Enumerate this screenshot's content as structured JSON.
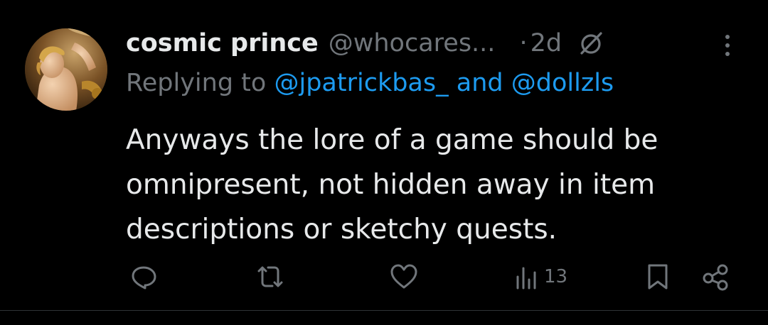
{
  "tweet": {
    "author": {
      "display_name": "cosmic prince",
      "handle": "@whocares...",
      "avatar_icon": "avatar-image"
    },
    "separator": "·",
    "timestamp": "2d",
    "reply": {
      "prefix": "Replying to",
      "mention1": "@jpatrickbas_",
      "conjunction": "and",
      "mention2": "@dollzls"
    },
    "text": "Anyways the lore of a game should be omnipresent, not hidden away in item descriptions or sketchy quests.",
    "actions": {
      "reply_icon": "reply-icon",
      "retweet_icon": "retweet-icon",
      "like_icon": "heart-icon",
      "views_icon": "views-icon",
      "views_count": "13",
      "bookmark_icon": "bookmark-icon",
      "share_icon": "share-icon"
    }
  },
  "colors": {
    "background": "#000000",
    "text_primary": "#e7e9ea",
    "text_secondary": "#71767b",
    "accent": "#1d9bf0"
  }
}
